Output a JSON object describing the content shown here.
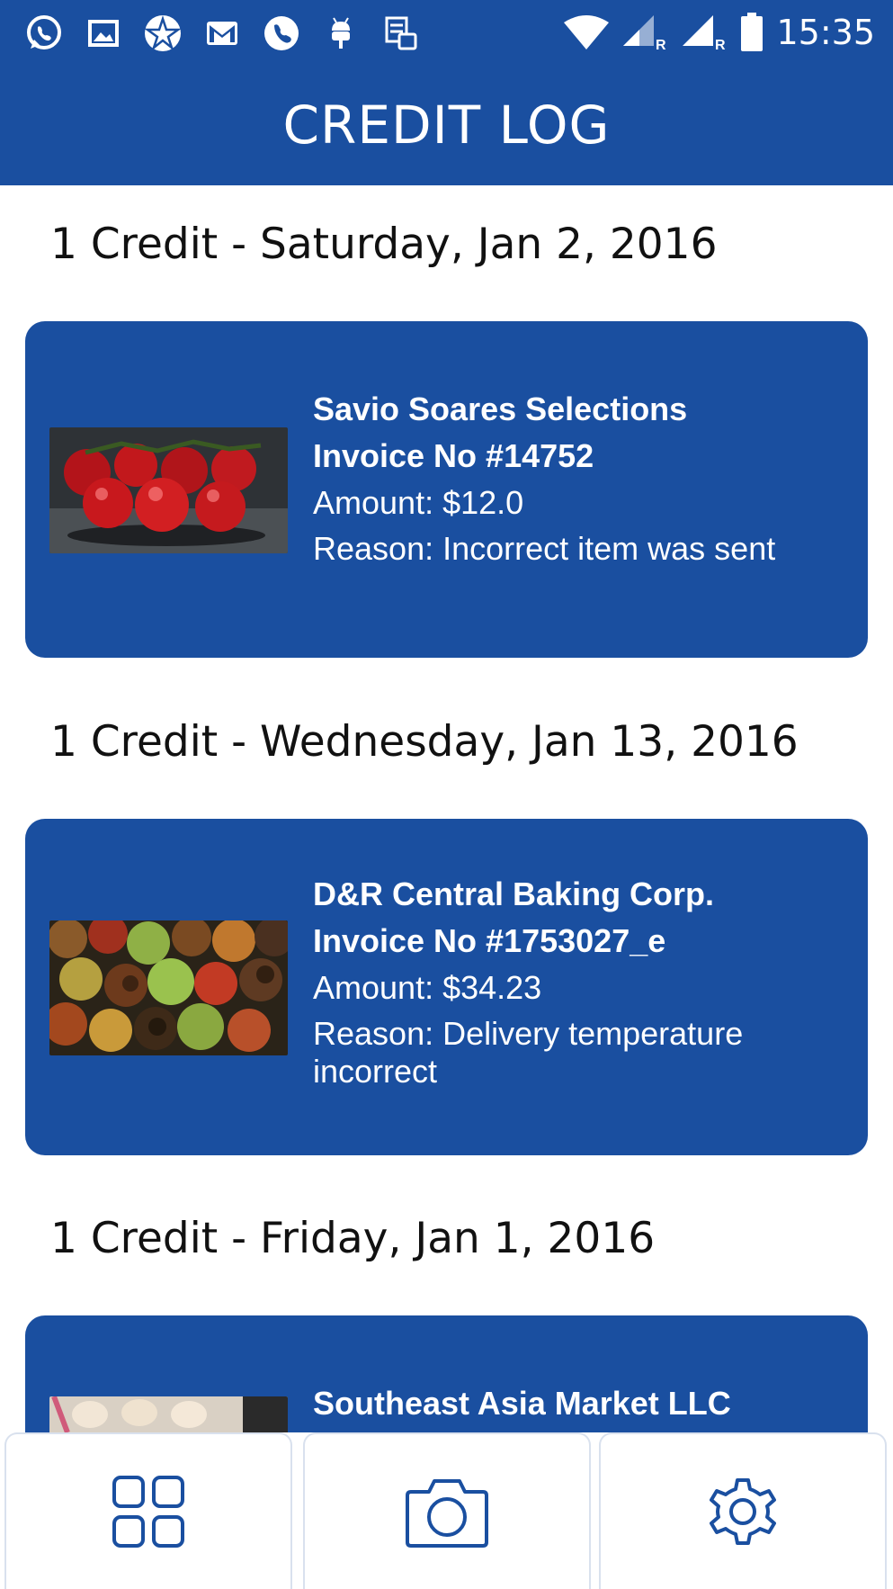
{
  "status_bar": {
    "time": "15:35",
    "left_icons": [
      "whatsapp-icon",
      "gallery-icon",
      "star-app-icon",
      "gmail-icon",
      "phone-icon",
      "android-debug-icon",
      "sim-toolkit-icon"
    ],
    "right_icons": [
      "wifi-icon",
      "signal-icon",
      "signal-icon",
      "battery-icon"
    ]
  },
  "app_bar": {
    "title": "CREDIT LOG"
  },
  "credit_log": [
    {
      "header": "1 Credit - Saturday, Jan 2, 2016",
      "vendor": "Savio Soares Selections",
      "invoice": "Invoice No #14752",
      "amount": "Amount: $12.0",
      "reason": "Reason: Incorrect item was sent",
      "image": "tomatoes"
    },
    {
      "header": "1 Credit - Wednesday, Jan 13, 2016",
      "vendor": "D&R Central Baking Corp.",
      "invoice": "Invoice No #1753027_e",
      "amount": "Amount: $34.23",
      "reason": "Reason: Delivery temperature incorrect",
      "image": "rotten-apples"
    },
    {
      "header": "1 Credit - Friday, Jan 1, 2016",
      "vendor": "Southeast Asia Market LLC",
      "image": "eggs"
    }
  ],
  "bottom_nav": {
    "items": [
      {
        "icon": "grid-icon"
      },
      {
        "icon": "camera-icon"
      },
      {
        "icon": "settings-gear-icon"
      }
    ]
  },
  "colors": {
    "primary": "#1a4fa0",
    "nav_border": "#d9e1ee",
    "icon_stroke": "#1a4fa0"
  }
}
